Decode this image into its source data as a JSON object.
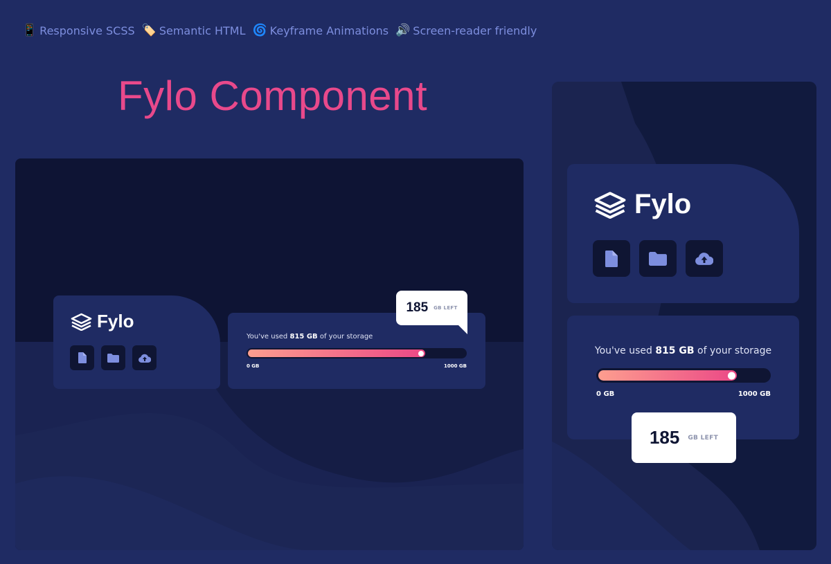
{
  "features": [
    {
      "emoji": "📱",
      "label": "Responsive SCSS"
    },
    {
      "emoji": "🏷️",
      "label": "Semantic HTML"
    },
    {
      "emoji": "🌀",
      "label": "Keyframe Animations"
    },
    {
      "emoji": "🔊",
      "label": "Screen-reader friendly"
    }
  ],
  "title": "Fylo Component",
  "brand": {
    "name": "Fylo",
    "icon": "stacked-layers-icon"
  },
  "actions": [
    {
      "icon": "document-icon"
    },
    {
      "icon": "folder-icon"
    },
    {
      "icon": "cloud-upload-icon"
    }
  ],
  "usage": {
    "prefix": "You've used",
    "used": "815 GB",
    "suffix": "of your storage",
    "min_label": "0 GB",
    "max_label": "1000 GB",
    "fraction_used": 0.815
  },
  "remaining": {
    "value": "185",
    "unit": "GB LEFT"
  },
  "colors": {
    "page_bg": "#1f2b63",
    "card_bg": "#1f2b63",
    "dark_bg": "#0f1533",
    "accent_pink": "#e8498b",
    "gradient_start": "#fd9e8f",
    "gradient_end": "#eb4886",
    "icon_blue": "#7d8ede"
  }
}
